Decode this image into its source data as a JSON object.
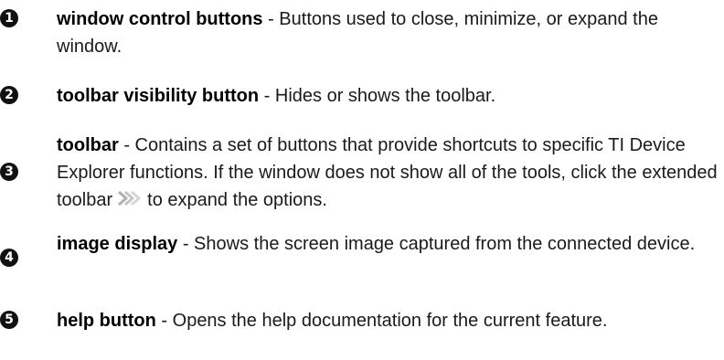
{
  "items": [
    {
      "num": "1",
      "term": "window control buttons",
      "desc": " - Buttons used to close, minimize, or expand the window."
    },
    {
      "num": "2",
      "term": "toolbar visibility button",
      "desc": " - Hides or shows the toolbar."
    },
    {
      "num": "3",
      "term": "toolbar",
      "desc_before": " - Contains a set of buttons that provide shortcuts to specific TI Device Explorer functions. If the window does not show all of the tools, click the extended toolbar",
      "desc_after": "to expand the options.",
      "icon": "extended-toolbar-chevron-icon"
    },
    {
      "num": "4",
      "term": "image display",
      "desc": " - Shows the screen image captured from the connected device."
    },
    {
      "num": "5",
      "term": "help button",
      "desc": " - Opens the help documentation for the current feature."
    }
  ]
}
